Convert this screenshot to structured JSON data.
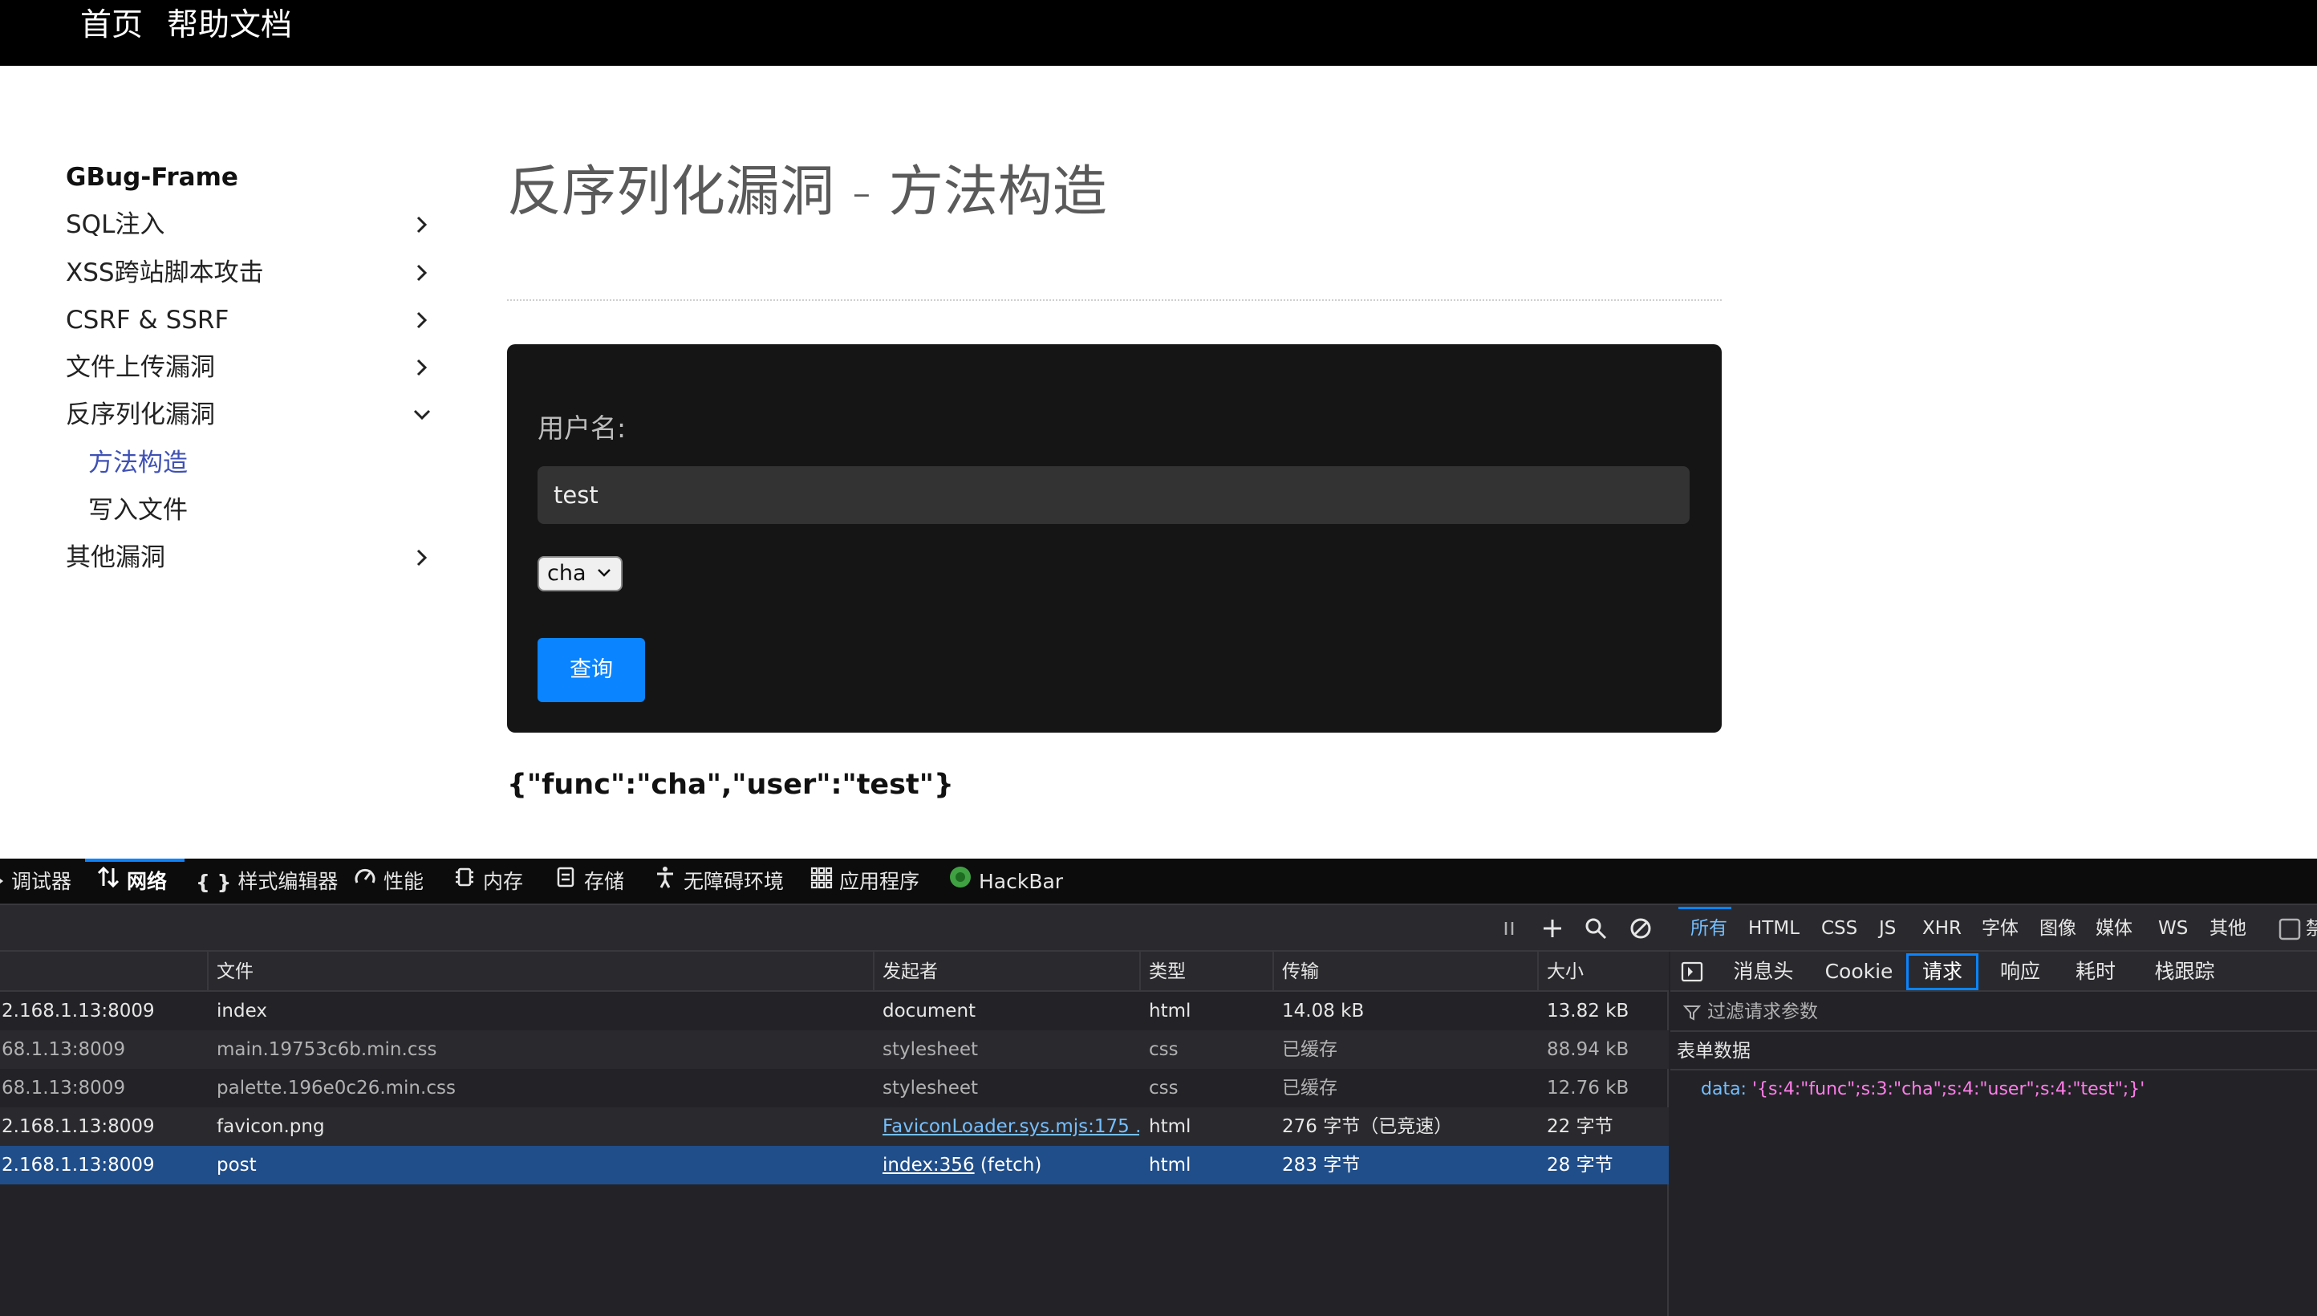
{
  "topnav": {
    "home": "首页",
    "help": "帮助文档"
  },
  "sidebar": {
    "title": "GBug-Frame",
    "items": [
      {
        "label": "SQL注入"
      },
      {
        "label": "XSS跨站脚本攻击"
      },
      {
        "label": "CSRF & SSRF"
      },
      {
        "label": "文件上传漏洞"
      },
      {
        "label": "反序列化漏洞"
      },
      {
        "label": "其他漏洞"
      }
    ],
    "subitems": [
      {
        "label": "方法构造",
        "active": true
      },
      {
        "label": "写入文件"
      }
    ]
  },
  "main": {
    "title": "反序列化漏洞 - 方法构造",
    "form": {
      "username_label": "用户名:",
      "username_value": "test",
      "select_value": "cha",
      "submit_label": "查询"
    },
    "result": "{\"func\":\"cha\",\"user\":\"test\"}"
  },
  "devtools": {
    "tabs": [
      "调试器",
      "网络",
      "样式编辑器",
      "性能",
      "内存",
      "存储",
      "无障碍环境",
      "应用程序",
      "HackBar"
    ],
    "active_tab": "网络",
    "filter_tabs": [
      "所有",
      "HTML",
      "CSS",
      "JS",
      "XHR",
      "字体",
      "图像",
      "媒体",
      "WS",
      "其他"
    ],
    "active_filter": "所有",
    "disable_label": "禁",
    "columns": [
      "文件",
      "发起者",
      "类型",
      "传输",
      "大小"
    ],
    "rows": [
      {
        "host": "2.168.1.13:8009",
        "file": "index",
        "initiator": "document",
        "type": "html",
        "transfer": "14.08 kB",
        "size": "13.82 kB"
      },
      {
        "host": "68.1.13:8009",
        "file": "main.19753c6b.min.css",
        "initiator": "stylesheet",
        "type": "css",
        "transfer": "已缓存",
        "size": "88.94 kB"
      },
      {
        "host": "68.1.13:8009",
        "file": "palette.196e0c26.min.css",
        "initiator": "stylesheet",
        "type": "css",
        "transfer": "已缓存",
        "size": "12.76 kB"
      },
      {
        "host": "2.168.1.13:8009",
        "file": "favicon.png",
        "initiator_link": "FaviconLoader.sys.mjs:175 ...",
        "type": "html",
        "transfer": "276 字节（已竞速）",
        "size": "22 字节"
      },
      {
        "host": "2.168.1.13:8009",
        "file": "post",
        "initiator_link": "index:356",
        "initiator_suffix": " (fetch)",
        "type": "html",
        "transfer": "283 字节",
        "size": "28 字节"
      }
    ],
    "panel": {
      "tabs": [
        "消息头",
        "Cookie",
        "请求",
        "响应",
        "耗时",
        "栈跟踪"
      ],
      "active_tab": "请求",
      "filter_placeholder": "过滤请求参数",
      "section": "表单数据",
      "param_key": "data:",
      "param_value": "'{s:4:\"func\";s:3:\"cha\";s:4:\"user\";s:4:\"test\";}'"
    },
    "colors": {
      "accent": "#0a84ff",
      "selected_row": "#204e8a",
      "link": "#75bfff",
      "string": "#ff7de9"
    }
  }
}
